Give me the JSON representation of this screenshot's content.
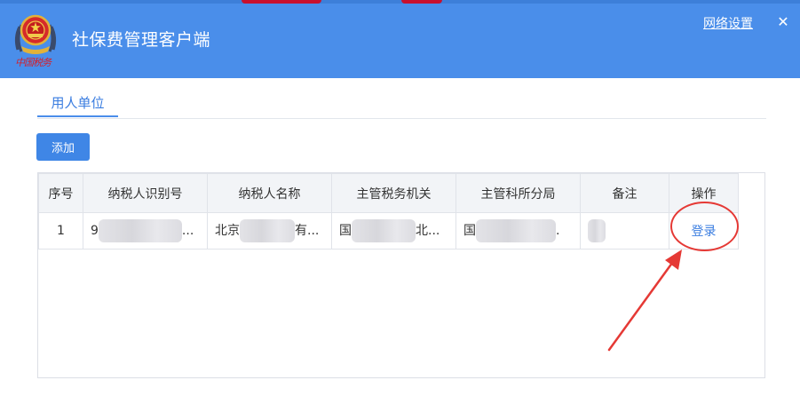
{
  "header": {
    "title": "社保费管理客户端",
    "logo_caption": "中国税务",
    "network_settings_label": "网络设置",
    "close_glyph": "✕",
    "accent_color": "#4a8eea"
  },
  "tabs": [
    {
      "label": "用人单位",
      "active": true
    }
  ],
  "toolbar": {
    "add_label": "添加"
  },
  "table": {
    "columns": [
      "序号",
      "纳税人识别号",
      "纳税人名称",
      "主管税务机关",
      "主管科所分局",
      "备注",
      "操作"
    ],
    "rows": [
      {
        "index": "1",
        "taxpayer_id_prefix": "9",
        "taxpayer_id_suffix": "...",
        "taxpayer_name_prefix": "北京",
        "taxpayer_name_suffix": "有...",
        "tax_authority_prefix": "国",
        "tax_authority_suffix": "北...",
        "tax_branch_prefix": "国",
        "tax_branch_suffix": ".",
        "remark": "",
        "action_label": "登录"
      }
    ]
  },
  "annotation_color": "#e53935"
}
